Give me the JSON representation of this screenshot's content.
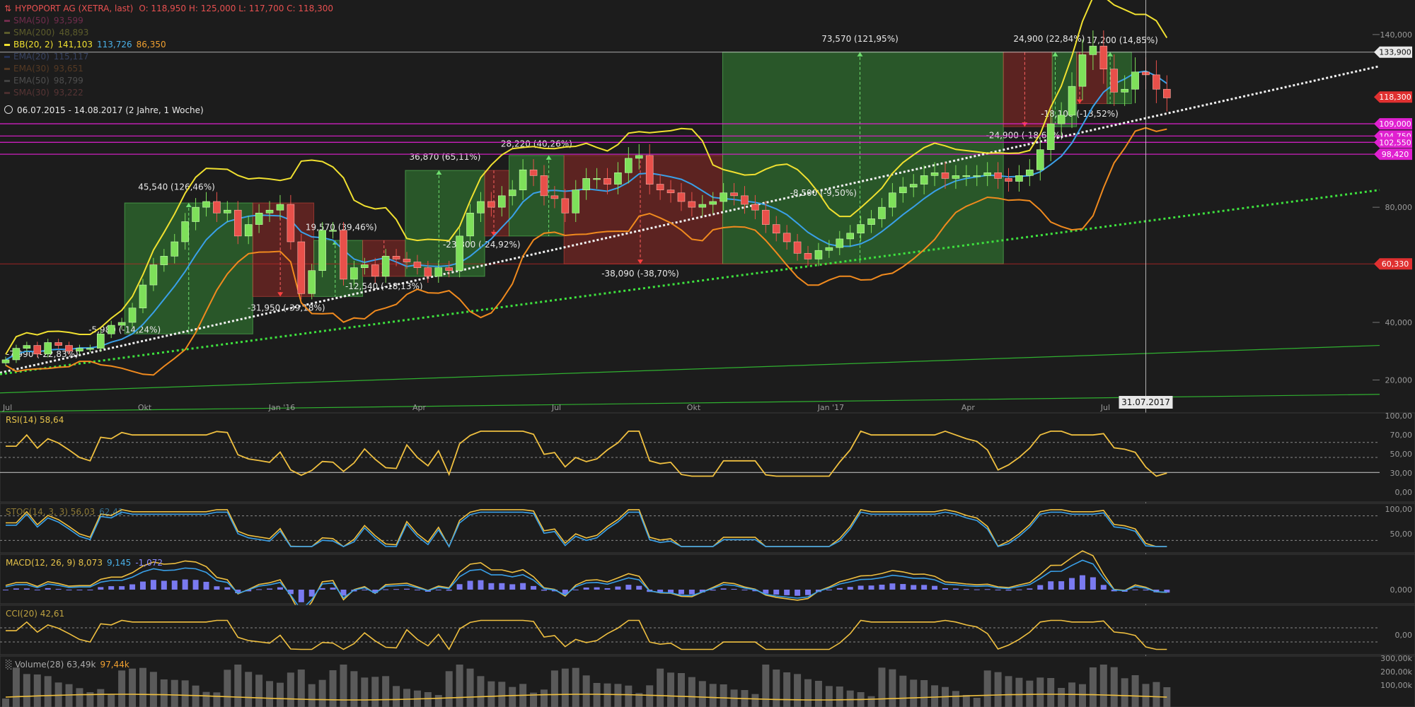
{
  "header": {
    "title": "HYPOPORT AG (XETRA, last)",
    "ohlc": "O: 118,950  H: 125,000  L: 117,700  C: 118,300",
    "indicators": [
      {
        "label": "SMA(50)",
        "value": "93,599",
        "color": "#c43c7c",
        "dim": true
      },
      {
        "label": "SMA(200)",
        "value": "48,893",
        "color": "#9a9a3a",
        "dim": true
      },
      {
        "label": "BB(20, 2)",
        "value": "141,103",
        "value2": "113,726",
        "value3": "86,350",
        "color": "#f0e030",
        "dim": false
      },
      {
        "label": "EMA(20)",
        "value": "115,117",
        "color": "#3a5ac0",
        "dim": true
      },
      {
        "label": "EMA(30)",
        "value": "93,651",
        "color": "#c07030",
        "dim": true
      },
      {
        "label": "EMA(50)",
        "value": "98,799",
        "color": "#707070",
        "dim": true
      },
      {
        "label": "SMA(30)",
        "value": "93,222",
        "color": "#a05050",
        "dim": true
      }
    ],
    "period": "06.07.2015 - 14.08.2017   (2 Jahre, 1 Woche)"
  },
  "panes": {
    "rsi": {
      "label": "RSI(14)",
      "value": "58,64"
    },
    "stoch": {
      "label": "STOC(14, 3, 3)",
      "value": "56,03",
      "value2": "62,41"
    },
    "macd": {
      "label": "MACD(12, 26, 9)",
      "value": "8,073",
      "value2": "9,145",
      "value3": "-1,072"
    },
    "cci": {
      "label": "CCI(20)",
      "value": "42,61"
    },
    "volume": {
      "label": "Volume(28)",
      "value": "63,49k",
      "value2": "97,44k"
    }
  },
  "colors": {
    "background": "#1c1c1c",
    "up": "#7ee05a",
    "down": "#e8504a",
    "bb": "#f0e030",
    "sma": "#3aa0e8",
    "lowerband": "#f08a1e",
    "magenta": "#e020d0",
    "rsi": "#f0c040"
  },
  "chart_data": {
    "type": "candlestick",
    "title": "HYPOPORT AG (XETRA, last)",
    "x_ticks": [
      "Jul",
      "Okt",
      "Jan '16",
      "Apr",
      "Jul",
      "Okt",
      "Jan '17",
      "Apr",
      "Jul"
    ],
    "x_tick_weeks": [
      0,
      13,
      26,
      39,
      52,
      65,
      78,
      91,
      104
    ],
    "crosshair_label": "31.07.2017",
    "crosshair_week": 108,
    "y_ticks": [
      20000,
      40000,
      80000,
      140000
    ],
    "y_tick_labels": [
      "20,000",
      "40,000",
      "80,000",
      "140,000"
    ],
    "ylim": [
      12000,
      152000
    ],
    "price_markers": [
      {
        "label": "133,900",
        "value": 133900,
        "style": "white"
      },
      {
        "label": "118,300",
        "value": 118300,
        "style": "red"
      },
      {
        "label": "109,000",
        "value": 109000,
        "style": "magenta"
      },
      {
        "label": "104,750",
        "value": 104750,
        "style": "magenta"
      },
      {
        "label": "102,550",
        "value": 102550,
        "style": "magenta"
      },
      {
        "label": "98,420",
        "value": 98420,
        "style": "magenta"
      },
      {
        "label": "60,330",
        "value": 60330,
        "style": "red"
      }
    ],
    "closes": [
      27,
      31,
      32,
      29,
      33,
      32,
      30,
      31,
      31,
      36,
      39,
      40,
      45,
      53,
      60,
      63,
      68,
      75,
      80,
      82,
      78,
      79,
      70,
      74,
      78,
      79,
      81,
      68,
      50,
      58,
      72,
      72,
      55,
      59,
      60,
      56,
      63,
      62,
      61,
      59,
      56,
      59,
      58,
      70,
      78,
      82,
      80,
      84,
      86,
      93,
      91,
      84,
      83,
      78,
      86,
      90,
      90,
      88,
      92,
      97,
      98,
      88,
      86,
      85,
      82,
      80,
      81,
      82,
      85,
      84,
      81,
      79,
      74,
      71,
      68,
      64,
      62,
      65,
      66,
      69,
      71,
      74,
      76,
      80,
      85,
      87,
      88,
      91,
      92,
      90,
      91,
      91,
      91,
      92,
      90,
      89,
      91,
      93,
      100,
      109,
      112,
      122,
      133,
      136,
      128,
      120,
      121,
      127,
      126,
      121,
      118
    ],
    "rect_annotations": [
      {
        "x0": 19.5,
        "x1": 40.5,
        "y0": 36000,
        "y1": 81500,
        "color": "green",
        "label": "45,540 (126,46%)",
        "label_week": 28,
        "label_value": 86000,
        "arrow": "up",
        "arrow_week": 30
      },
      {
        "x0": 40.5,
        "x1": 50.5,
        "y0": 49000,
        "y1": 81500,
        "color": "red",
        "label": "-31,950 (-39,18%)",
        "label_week": 46,
        "label_value": 44000,
        "arrow": "down",
        "arrow_week": 45
      },
      {
        "x0": 50.5,
        "x1": 58.5,
        "y0": 49000,
        "y1": 68500,
        "color": "green",
        "label": "19,570 (39,46%)",
        "label_week": 55,
        "label_value": 72000,
        "arrow": "up",
        "arrow_week": 54
      },
      {
        "x0": 58.5,
        "x1": 65.5,
        "y0": 56000,
        "y1": 68500,
        "color": "red",
        "label": "-12,540 (-18,13%)",
        "label_week": 62,
        "label_value": 51500,
        "arrow": "down",
        "arrow_week": 62
      },
      {
        "x0": 65.5,
        "x1": 78.5,
        "y0": 56000,
        "y1": 92800,
        "color": "green",
        "label": "36,870 (65,11%)",
        "label_week": 72,
        "label_value": 96500,
        "arrow": "up",
        "arrow_week": 71
      },
      {
        "x0": 78.5,
        "x1": 82.5,
        "y0": 70000,
        "y1": 92800,
        "color": "red",
        "label": "-23,300 (-24,92%)",
        "label_week": 78,
        "label_value": 66000,
        "arrow": "down",
        "arrow_week": 80
      },
      {
        "x0": 82.5,
        "x1": 91.5,
        "y0": 70000,
        "y1": 98000,
        "color": "green",
        "label": "28,220 (40,26%)",
        "label_week": 87,
        "label_value": 101000,
        "arrow": "up",
        "arrow_week": 89
      },
      {
        "x0": 91.5,
        "x1": 117.5,
        "y0": 60330,
        "y1": 98000,
        "color": "red",
        "label": "-38,090 (-38,70%)",
        "label_week": 104,
        "label_value": 56000,
        "arrow": "down",
        "arrow_week": 104
      },
      {
        "x0": 117.5,
        "x1": 163.5,
        "y0": 60330,
        "y1": 133900,
        "color": "green",
        "label": "73,570 (121,95%)",
        "label_week": 140,
        "label_value": 137500,
        "arrow": "up",
        "arrow_week": 140
      },
      {
        "x0": 163.5,
        "x1": 171.5,
        "y0": 108000,
        "y1": 133900,
        "color": "red",
        "label": "-24,900 (-18,60%)",
        "label_week": 167,
        "label_value": 104000,
        "arrow": "down",
        "arrow_week": 167
      },
      {
        "x0": 171.5,
        "x1": 175.5,
        "y0": 108000,
        "y1": 133900,
        "color": "green",
        "label": "24,900 (22,84%)",
        "label_week": 171,
        "label_value": 137500,
        "arrow": "up",
        "arrow_week": 172
      },
      {
        "x0": 175.5,
        "x1": 180.5,
        "y0": 116000,
        "y1": 133900,
        "color": "red",
        "label": "-18,100 (-13,52%)",
        "label_week": 176,
        "label_value": 111500,
        "arrow": "down",
        "arrow_week": 176
      },
      {
        "x0": 180.5,
        "x1": 184.5,
        "y0": 116000,
        "y1": 133900,
        "color": "green",
        "label": "17,200 (14,85%)",
        "label_week": 183,
        "label_value": 137000,
        "arrow": "up",
        "arrow_week": 181
      }
    ],
    "small_labels": [
      {
        "label": "-5,980 (-14,24%)",
        "week": 19.5,
        "value": 36500
      },
      {
        "label": "-7,990 (-22,83%)",
        "week": 6,
        "value": 28000
      },
      {
        "label": "-8,500 (-9,50%)",
        "week": 134,
        "value": 84000
      }
    ],
    "rsi": {
      "ticks": [
        "100,00",
        "70,00",
        "50,00",
        "30,00",
        "0,00"
      ],
      "marker": "70,00"
    },
    "stoch": {
      "ticks": [
        "100,00",
        "50,00"
      ],
      "marker": "50,00"
    },
    "macd": {
      "ticks": [
        "0,000"
      ]
    },
    "cci": {
      "ticks": [
        "0,00"
      ]
    },
    "volume": {
      "ticks": [
        "300,00k",
        "200,00k",
        "100,00k"
      ]
    }
  }
}
